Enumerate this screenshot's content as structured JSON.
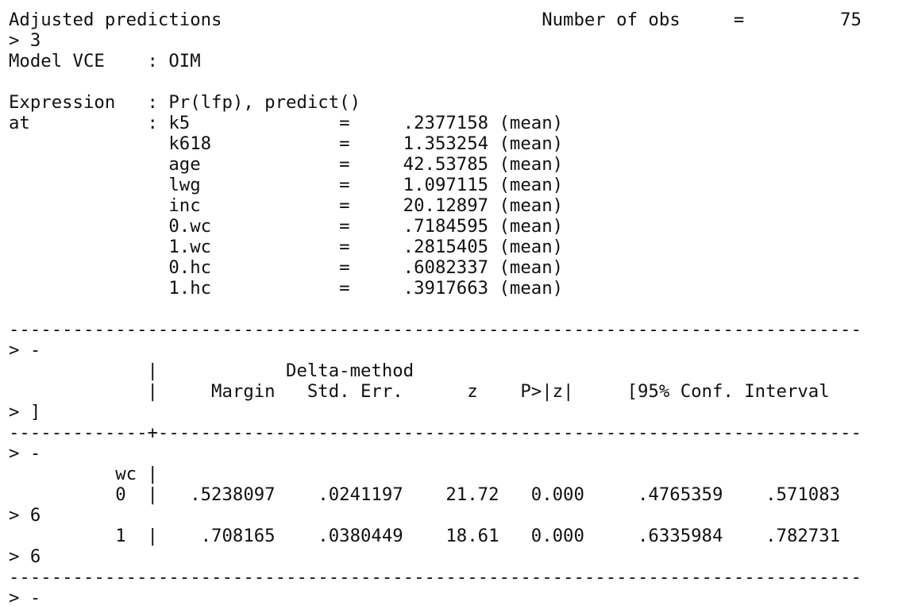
{
  "console": {
    "lines": [
      "Adjusted predictions                              Number of obs     =         75",
      "> 3",
      "Model VCE    : OIM",
      "",
      "Expression   : Pr(lfp), predict()",
      "at           : k5              =     .2377158 (mean)",
      "               k618            =     1.353254 (mean)",
      "               age             =     42.53785 (mean)",
      "               lwg             =     1.097115 (mean)",
      "               inc             =     20.12897 (mean)",
      "               0.wc            =     .7184595 (mean)",
      "               1.wc            =     .2815405 (mean)",
      "               0.hc            =     .6082337 (mean)",
      "               1.hc            =     .3917663 (mean)",
      "",
      "--------------------------------------------------------------------------------",
      "> -",
      "             |            Delta-method",
      "             |     Margin   Std. Err.      z    P>|z|     [95% Conf. Interval",
      "> ]",
      "-------------+------------------------------------------------------------------",
      "> -",
      "          wc |",
      "          0  |   .5238097    .0241197    21.72   0.000     .4765359    .571083",
      "> 6",
      "          1  |    .708165    .0380449    18.61   0.000     .6335984    .782731",
      "> 6",
      "--------------------------------------------------------------------------------",
      "> -"
    ]
  }
}
